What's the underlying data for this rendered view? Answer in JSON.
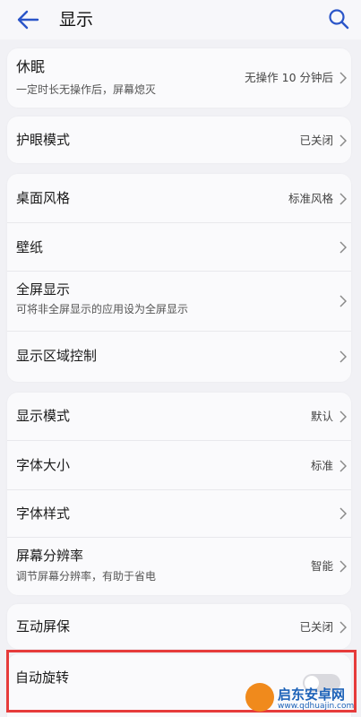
{
  "header": {
    "title": "显示",
    "back_icon": "back-arrow-icon",
    "search_icon": "search-icon"
  },
  "groups": {
    "sleep": {
      "label": "休眠",
      "subtitle": "一定时长无操作后，屏幕熄灭",
      "value": "无操作 10 分钟后"
    },
    "eye": {
      "label": "护眼模式",
      "value": "已关闭"
    },
    "desktop": {
      "label": "桌面风格",
      "value": "标准风格"
    },
    "wallpaper": {
      "label": "壁纸"
    },
    "fullscreen": {
      "label": "全屏显示",
      "subtitle": "可将非全屏显示的应用设为全屏显示"
    },
    "area": {
      "label": "显示区域控制"
    },
    "mode": {
      "label": "显示模式",
      "value": "默认"
    },
    "fontsize": {
      "label": "字体大小",
      "value": "标准"
    },
    "fontstyle": {
      "label": "字体样式"
    },
    "resolution": {
      "label": "屏幕分辨率",
      "subtitle": "调节屏幕分辨率，有助于省电",
      "value": "智能"
    },
    "screensaver": {
      "label": "互动屏保",
      "value": "已关闭"
    },
    "rotate": {
      "label": "自动旋转",
      "toggle_on": false
    }
  },
  "watermark": {
    "text": "启东安卓网",
    "url": "www.qdhuajin.com"
  },
  "colors": {
    "accent": "#2a55c8",
    "highlight": "#e63b3b"
  }
}
